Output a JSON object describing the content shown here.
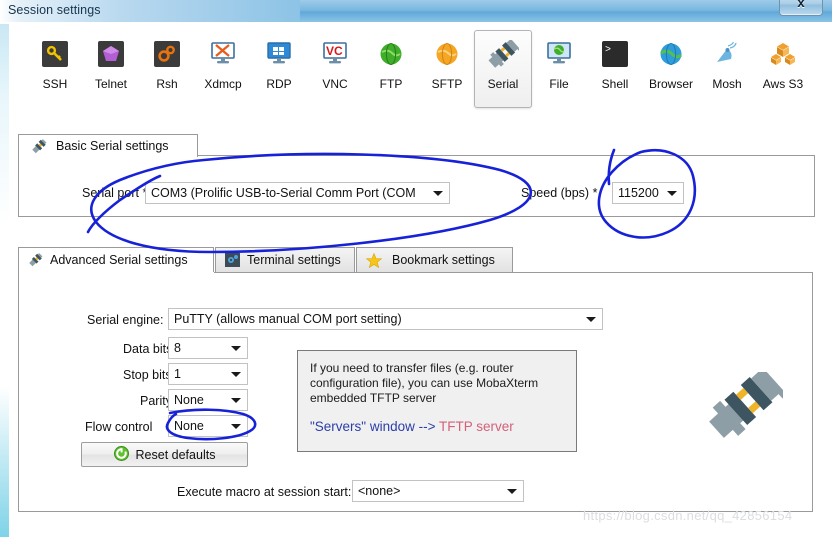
{
  "window": {
    "title": "Session settings",
    "close_label": "x"
  },
  "toolbar": {
    "items": [
      {
        "label": "SSH",
        "icon": "ssh-key-icon",
        "selected": false
      },
      {
        "label": "Telnet",
        "icon": "telnet-gem-icon",
        "selected": false
      },
      {
        "label": "Rsh",
        "icon": "rsh-gears-icon",
        "selected": false
      },
      {
        "label": "Xdmcp",
        "icon": "xdmcp-x-icon",
        "selected": false
      },
      {
        "label": "RDP",
        "icon": "rdp-monitor-icon",
        "selected": false
      },
      {
        "label": "VNC",
        "icon": "vnc-monitor-icon",
        "selected": false
      },
      {
        "label": "FTP",
        "icon": "ftp-globe-icon",
        "selected": false
      },
      {
        "label": "SFTP",
        "icon": "sftp-globe-icon",
        "selected": false
      },
      {
        "label": "Serial",
        "icon": "serial-plug-icon",
        "selected": true
      },
      {
        "label": "File",
        "icon": "file-monitor-icon",
        "selected": false
      },
      {
        "label": "Shell",
        "icon": "shell-prompt-icon",
        "selected": false
      },
      {
        "label": "Browser",
        "icon": "browser-globe-icon",
        "selected": false
      },
      {
        "label": "Mosh",
        "icon": "mosh-satellite-icon",
        "selected": false
      },
      {
        "label": "Aws S3",
        "icon": "aws-s3-boxes-icon",
        "selected": false
      }
    ]
  },
  "basic_group": {
    "tab_label": "Basic Serial settings",
    "tab_icon": "serial-plug-icon",
    "serial_port_label": "Serial port *",
    "serial_port_value": "COM3  (Prolific USB-to-Serial Comm Port (COM",
    "speed_label": "Speed (bps) *",
    "speed_value": "115200"
  },
  "tabs": [
    {
      "label": "Advanced Serial settings",
      "icon": "serial-plug-icon",
      "active": true
    },
    {
      "label": "Terminal settings",
      "icon": "terminal-gear-icon",
      "active": false
    },
    {
      "label": "Bookmark settings",
      "icon": "star-icon",
      "active": false
    }
  ],
  "advanced": {
    "serial_engine_label": "Serial engine:",
    "serial_engine_value": "PuTTY   (allows manual COM port setting)",
    "data_bits_label": "Data bits",
    "data_bits_value": "8",
    "stop_bits_label": "Stop bits",
    "stop_bits_value": "1",
    "parity_label": "Parity",
    "parity_value": "None",
    "flow_control_label": "Flow control",
    "flow_control_value": "None",
    "reset_label": "Reset defaults",
    "reset_icon": "reset-circle-icon",
    "macro_label": "Execute macro at session start:",
    "macro_value": "<none>",
    "decoration_icon": "serial-plug-large-icon"
  },
  "info_box": {
    "paragraph": "If you need to transfer files (e.g. router configuration file), you can use MobaXterm embedded TFTP server",
    "link_prefix": "\"Servers\" window  -->  ",
    "link_target": "TFTP server"
  },
  "watermark": {
    "text": "https://blog.csdn.net/qq_42856154"
  },
  "annotation": {
    "color": "#1722d8",
    "shapes": "hand-drawn-ellipses"
  }
}
